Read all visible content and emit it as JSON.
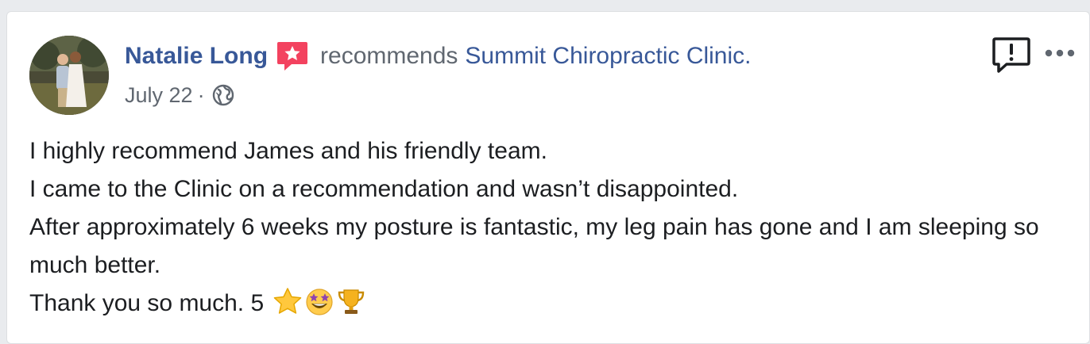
{
  "post": {
    "author": "Natalie Long",
    "recommends_text": "recommends",
    "page_name": "Summit Chiropractic Clinic.",
    "date": "July 22",
    "separator": "·",
    "privacy_icon": "globe-icon",
    "body_lines": [
      "I highly recommend James and his friendly team.",
      "I came to the Clinic on a recommendation and wasn’t disappointed.",
      "After approximately 6 weeks my posture is fantastic, my leg pain has gone and I am sleeping so much better.",
      "Thank you so much. 5"
    ],
    "emojis": [
      "star-emoji",
      "star-struck-emoji",
      "trophy-emoji"
    ]
  },
  "colors": {
    "link": "#385898",
    "secondary_text": "#606770",
    "body_text": "#1c1e21",
    "badge": "#f3425f"
  },
  "icons": {
    "recommendation_badge": "recommendation-badge-icon",
    "report": "report-icon",
    "more": "more-options-icon"
  }
}
